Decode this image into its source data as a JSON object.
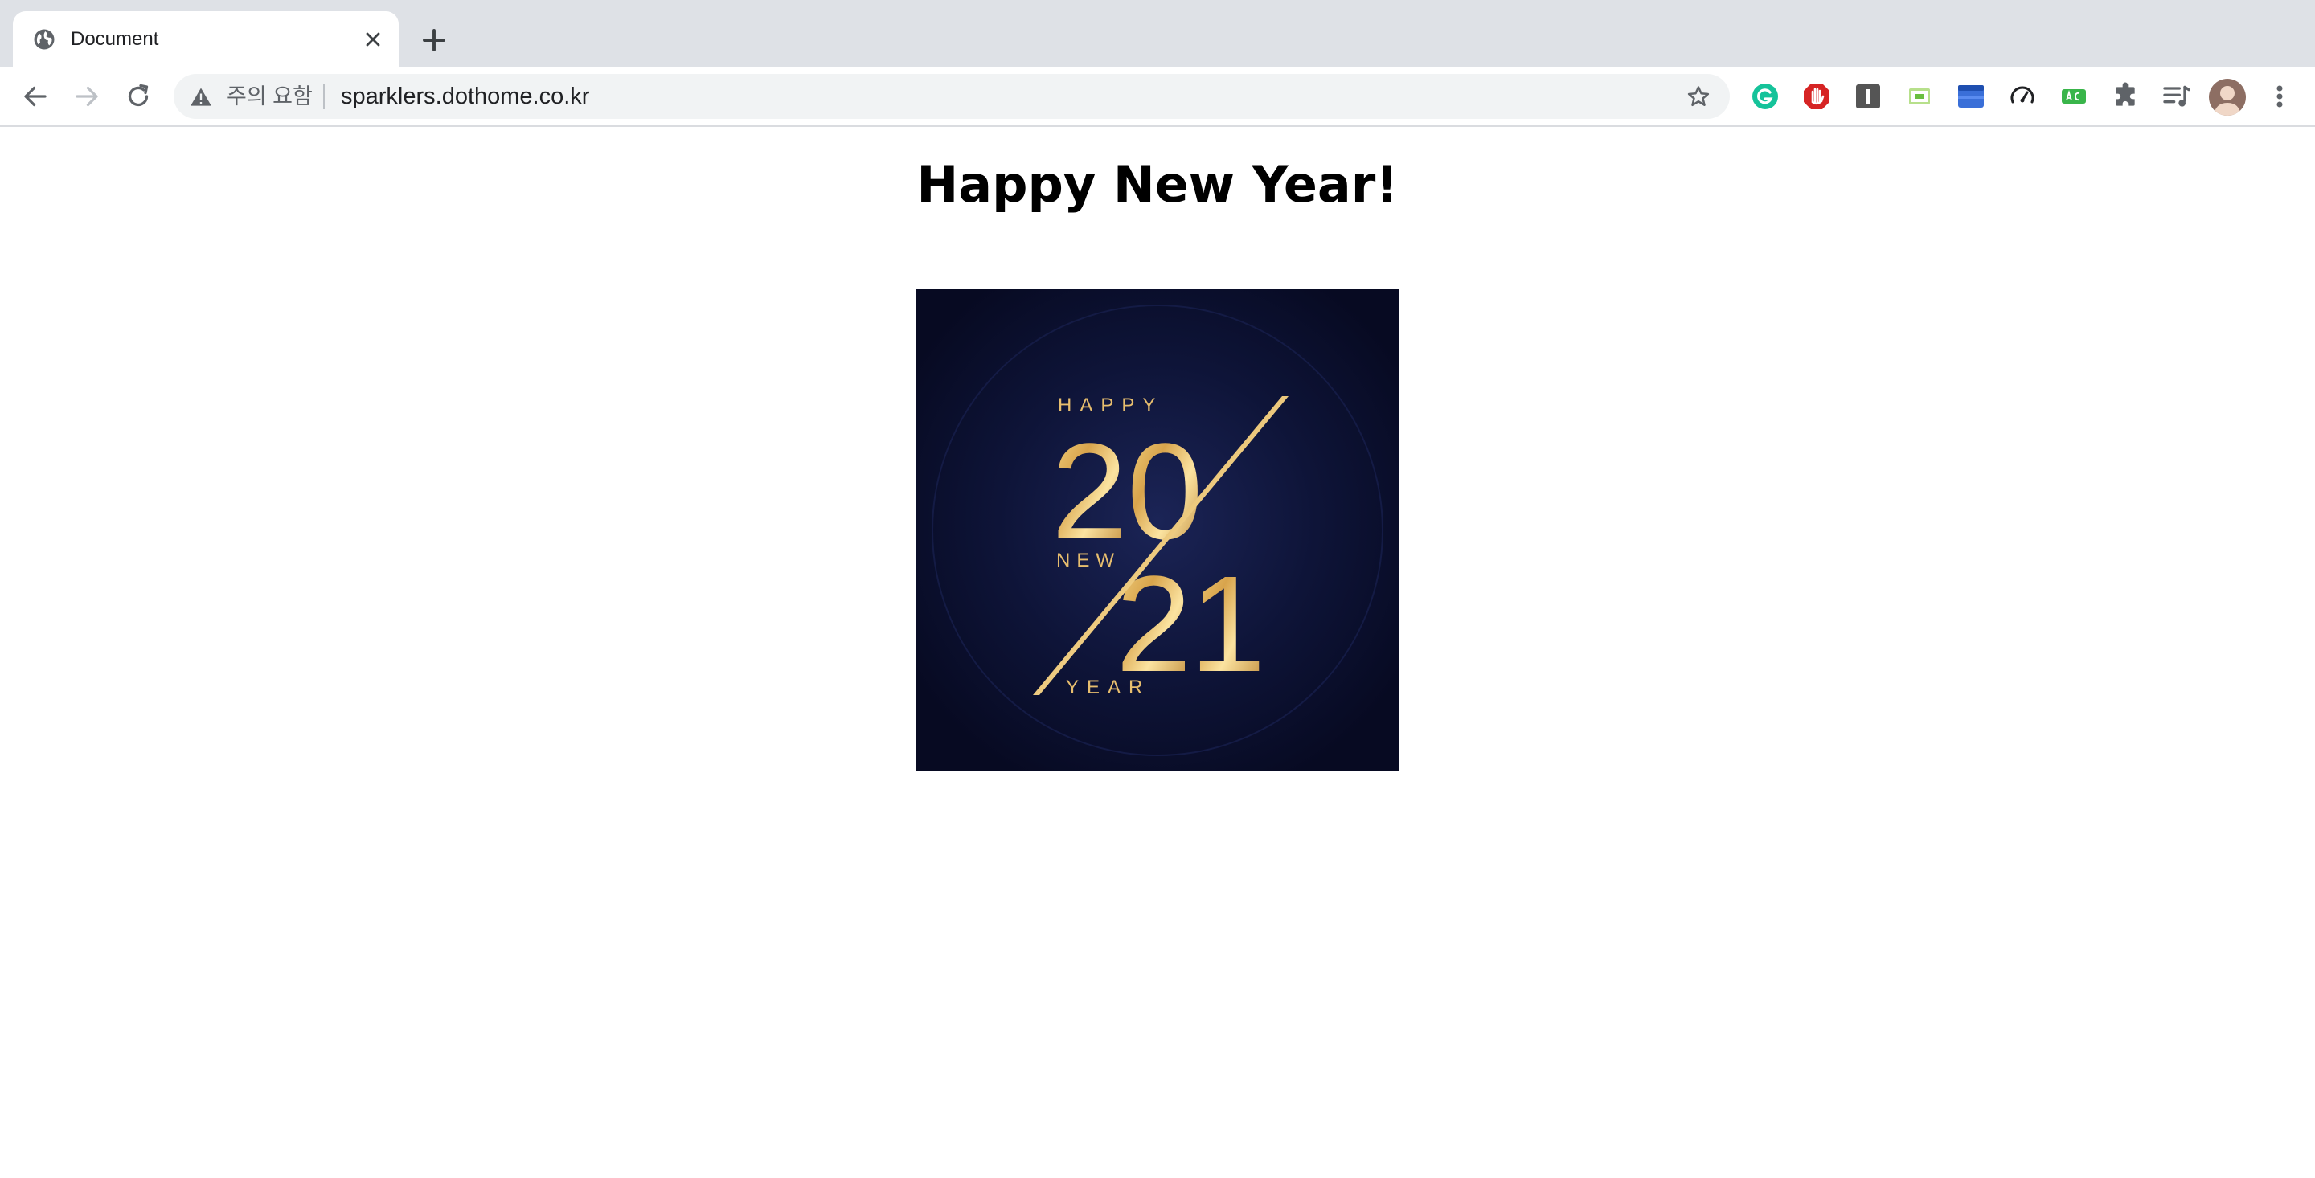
{
  "browser": {
    "tab": {
      "title": "Document",
      "favicon": "globe-icon"
    },
    "toolbar": {
      "security_label": "주의 요함",
      "url": "sparklers.dothome.co.kr"
    },
    "extensions": [
      "grammarly-icon",
      "adblock-icon",
      "instapaper-icon",
      "screen-capture-icon",
      "window-resizer-icon",
      "speedtest-icon",
      "autocomplete-icon",
      "extensions-puzzle-icon",
      "media-controls-icon"
    ]
  },
  "page": {
    "heading": "Happy New Year!",
    "image": {
      "lines": [
        "HAPPY",
        "NEW",
        "YEAR"
      ],
      "year_digits": [
        "2",
        "0",
        "2",
        "1"
      ]
    }
  },
  "colors": {
    "tabstrip": "#dee1e6",
    "omnibox": "#f1f3f4",
    "image_background": "#0b1030",
    "gold": "#e0b45c"
  }
}
